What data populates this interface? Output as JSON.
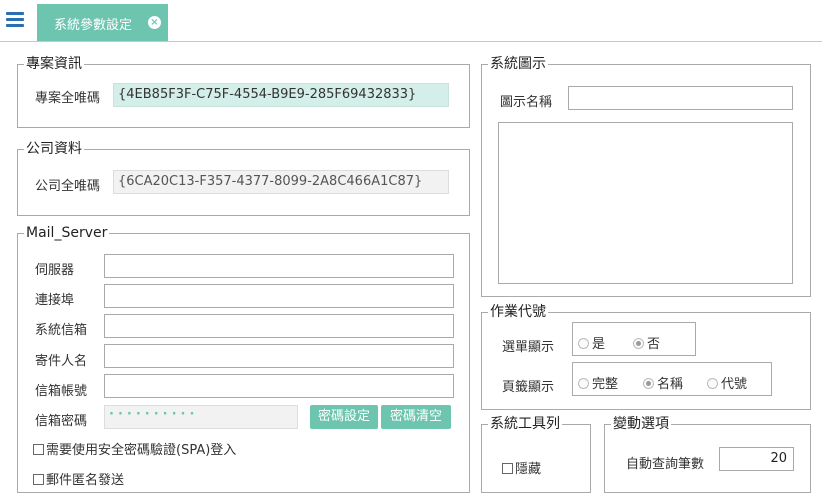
{
  "tab": {
    "label": "系統參數設定"
  },
  "project": {
    "legend": "專案資訊",
    "id_label": "專案全唯碼",
    "id_value": "{4EB85F3F-C75F-4554-B9E9-285F69432833}"
  },
  "company": {
    "legend": "公司資料",
    "id_label": "公司全唯碼",
    "id_value": "{6CA20C13-F357-4377-8099-2A8C466A1C87}"
  },
  "mail": {
    "legend": "Mail_Server",
    "server_label": "伺服器",
    "server_value": "",
    "port_label": "連接埠",
    "port_value": "",
    "sys_mail_label": "系統信箱",
    "sys_mail_value": "",
    "sender_label": "寄件人名",
    "sender_value": "",
    "account_label": "信箱帳號",
    "account_value": "",
    "password_label": "信箱密碼",
    "password_value": "··········",
    "set_password_button": "密碼設定",
    "clear_password_button": "密碼清空",
    "spa_label": "需要使用安全密碼驗證(SPA)登入",
    "anonymous_label": "郵件匿名發送"
  },
  "icon_panel": {
    "legend": "系統圖示",
    "name_label": "圖示名稱",
    "name_value": ""
  },
  "op_code": {
    "legend": "作業代號",
    "menu_label": "選單顯示",
    "menu_options": [
      "是",
      "否"
    ],
    "menu_selected": "否",
    "page_label": "頁籤顯示",
    "page_options": [
      "完整",
      "名稱",
      "代號"
    ],
    "page_selected": "名稱"
  },
  "toolbar": {
    "legend": "系統工具列",
    "hide_label": "隱藏"
  },
  "variable": {
    "legend": "變動選項",
    "auto_query_label": "自動查詢筆數",
    "auto_query_value": "20"
  },
  "colors": {
    "accent": "#6dc5b0",
    "menu_icon": "#2a6fb3"
  }
}
